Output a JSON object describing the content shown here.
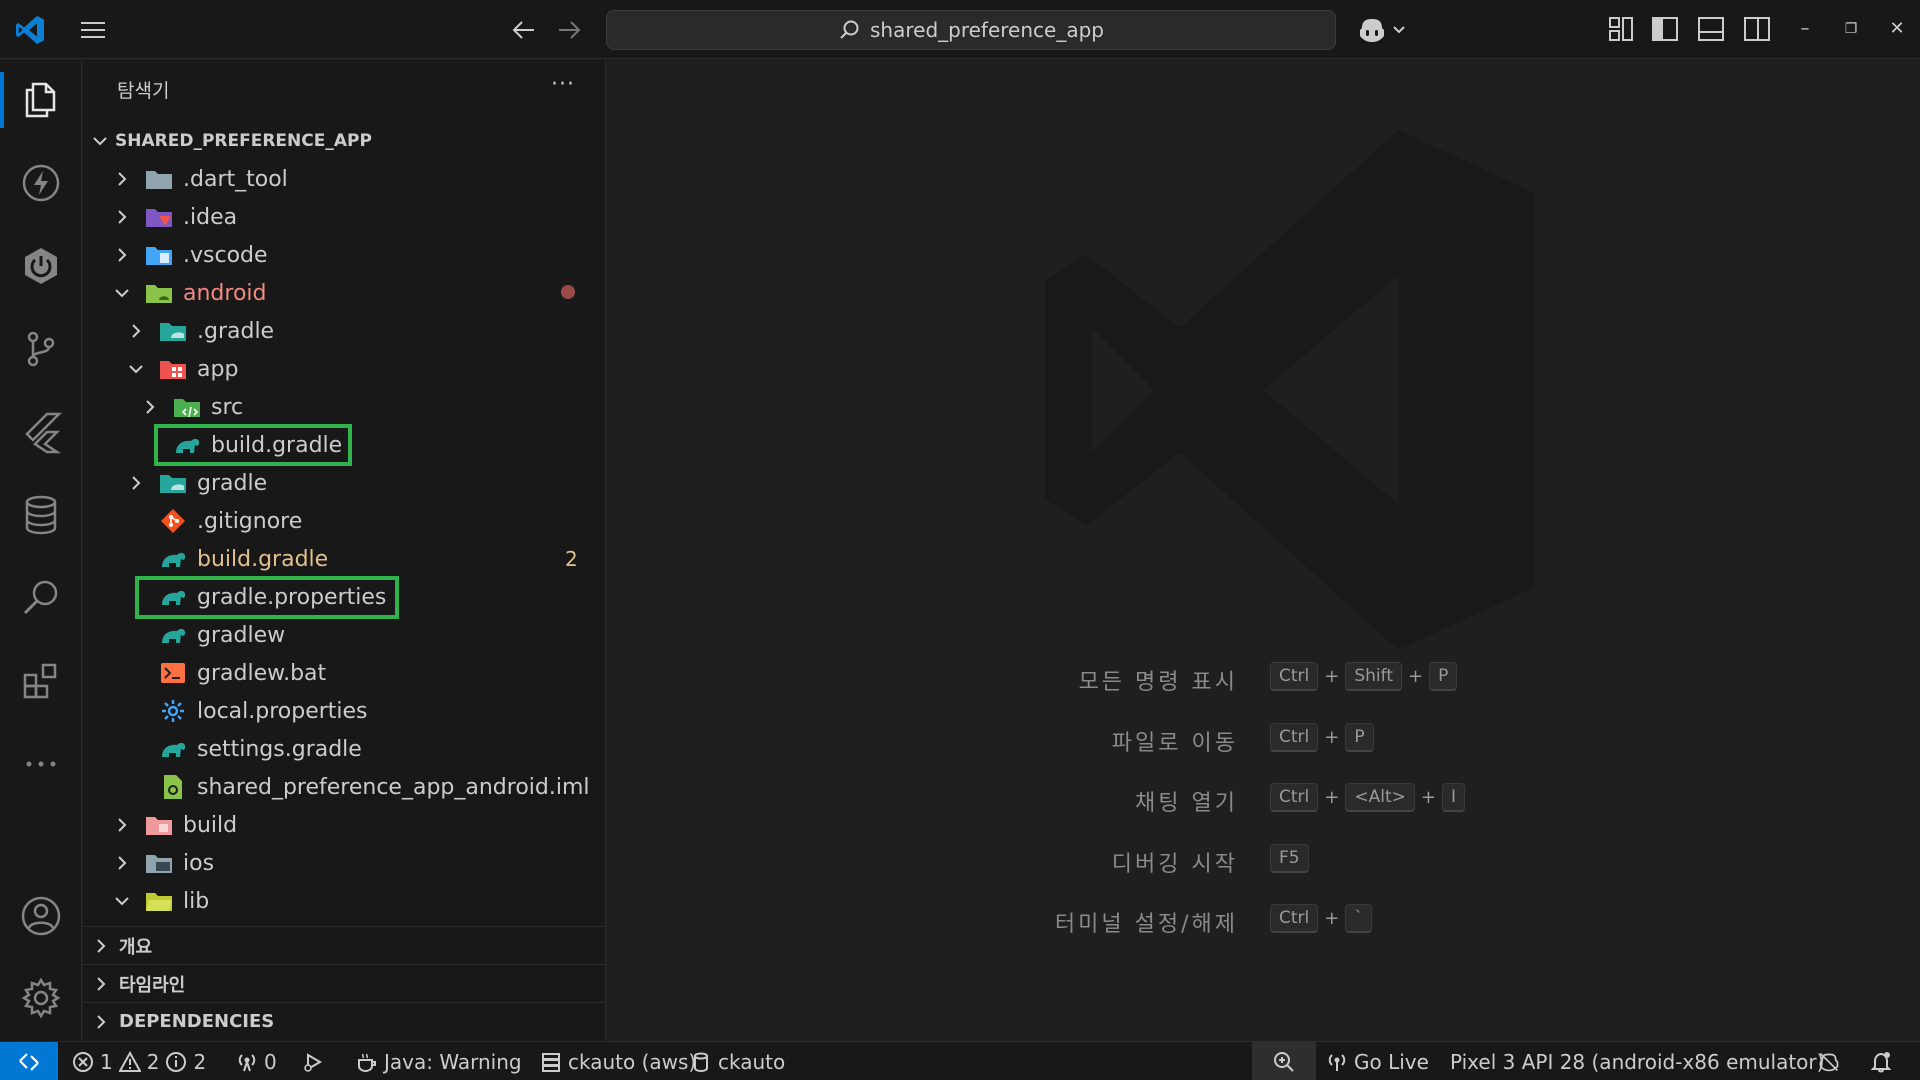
{
  "titlebar": {
    "search_text": "shared_preference_app"
  },
  "sidebar": {
    "title": "탐색기",
    "more": "···",
    "root": "SHARED_PREFERENCE_APP",
    "items": [
      {
        "label": ".dart_tool"
      },
      {
        "label": ".idea"
      },
      {
        "label": ".vscode"
      },
      {
        "label": "android"
      },
      {
        "label": ".gradle"
      },
      {
        "label": "app"
      },
      {
        "label": "src"
      },
      {
        "label": "build.gradle"
      },
      {
        "label": "gradle"
      },
      {
        "label": ".gitignore"
      },
      {
        "label": "build.gradle",
        "badge": "2"
      },
      {
        "label": "gradle.properties"
      },
      {
        "label": "gradlew"
      },
      {
        "label": "gradlew.bat"
      },
      {
        "label": "local.properties"
      },
      {
        "label": "settings.gradle"
      },
      {
        "label": "shared_preference_app_android.iml"
      },
      {
        "label": "build"
      },
      {
        "label": "ios"
      },
      {
        "label": "lib"
      }
    ],
    "sections": [
      {
        "label": "개요"
      },
      {
        "label": "타임라인"
      },
      {
        "label": "DEPENDENCIES"
      }
    ]
  },
  "editor": {
    "shortcuts": [
      {
        "label": "모든 명령 표시",
        "keys": [
          "Ctrl",
          "Shift",
          "P"
        ]
      },
      {
        "label": "파일로 이동",
        "keys": [
          "Ctrl",
          "P"
        ]
      },
      {
        "label": "채팅 열기",
        "keys": [
          "Ctrl",
          "<Alt>",
          "I"
        ]
      },
      {
        "label": "디버깅 시작",
        "keys": [
          "F5"
        ]
      },
      {
        "label": "터미널 설정/해제",
        "keys": [
          "Ctrl",
          "`"
        ]
      }
    ],
    "plus": "+"
  },
  "statusbar": {
    "errors": "1",
    "warnings": "2",
    "infos": "2",
    "ports": "0",
    "java": "Java: Warning",
    "aws": "ckauto (aws)",
    "db": "ckauto",
    "golive": "Go Live",
    "device": "Pixel 3 API 28 (android-x86 emulator)"
  },
  "colors": {
    "accent": "#0078d4",
    "highlight": "#2fb34a",
    "modified": "#e2c08d",
    "error": "#f28b82"
  }
}
